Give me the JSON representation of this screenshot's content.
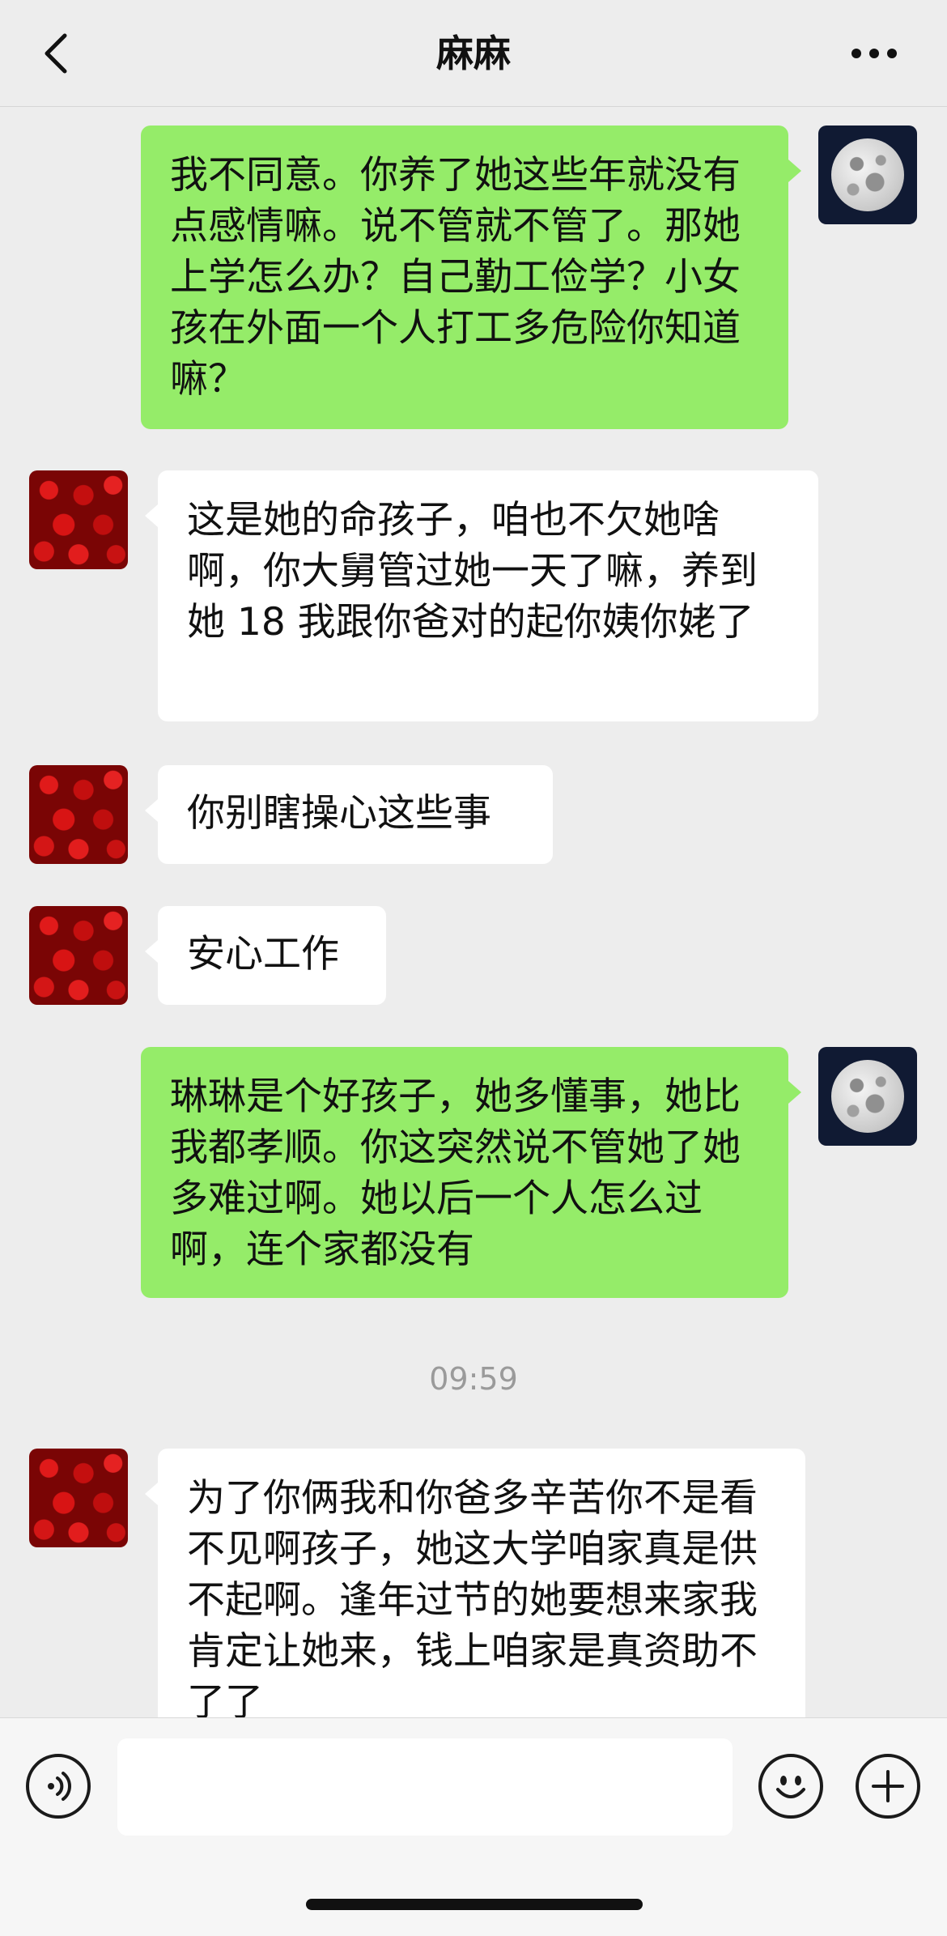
{
  "header": {
    "title": "麻麻",
    "back_icon": "chevron-left-icon",
    "more_icon": "ellipsis-icon"
  },
  "messages": [
    {
      "side": "out",
      "avatar": "moon",
      "text": "我不同意。你养了她这些年就没有点感情嘛。说不管就不管了。那她上学怎么办？自己勤工俭学？小女孩在外面一个人打工多危险你知道嘛？"
    },
    {
      "side": "in",
      "avatar": "roses",
      "text": "这是她的命孩子，咱也不欠她啥啊，你大舅管过她一天了嘛，养到她 18 我跟你爸对的起你姨你姥了"
    },
    {
      "side": "in",
      "avatar": "roses",
      "text": "你别瞎操心这些事"
    },
    {
      "side": "in",
      "avatar": "roses",
      "text": "安心工作"
    },
    {
      "side": "out",
      "avatar": "moon",
      "text": "琳琳是个好孩子，她多懂事，她比我都孝顺。你这突然说不管她了她多难过啊。她以后一个人怎么过啊，连个家都没有"
    },
    {
      "side": "in",
      "avatar": "roses",
      "text": "为了你俩我和你爸多辛苦你不是看不见啊孩子，她这大学咱家真是供不起啊。逢年过节的她要想来家我肯定让她来，钱上咱家是真资助不了了"
    }
  ],
  "timestamp": "09:59",
  "colors": {
    "outgoing_bubble": "#95ec69",
    "incoming_bubble": "#ffffff",
    "background": "#ededed"
  },
  "input_bar": {
    "voice_icon": "voice-icon",
    "emoji_icon": "emoji-icon",
    "plus_icon": "plus-icon",
    "placeholder": ""
  }
}
